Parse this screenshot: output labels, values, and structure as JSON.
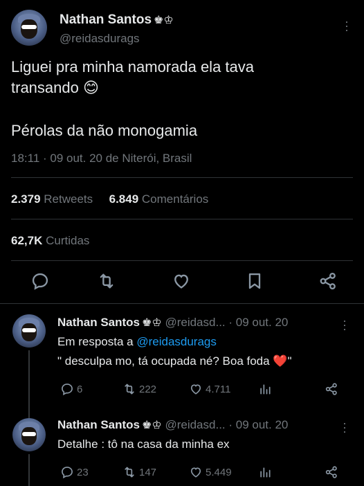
{
  "main_tweet": {
    "author_name": "Nathan Santos",
    "author_badge": "♚♔",
    "handle": "@reidasdurags",
    "text": "Liguei pra minha namorada ela tava\ntransando 😊",
    "text2": "Pérolas da não monogamia",
    "timestamp": "18:11 · 09 out. 20 de Niterói, Brasil",
    "retweets_count": "2.379",
    "retweets_label": "Retweets",
    "comments_count": "6.849",
    "comments_label": "Comentários",
    "likes_count": "62,7K",
    "likes_label": "Curtidas"
  },
  "replies": [
    {
      "author_name": "Nathan Santos",
      "author_badge": "♚♔",
      "handle_time": "@reidasd... · 09 out. 20",
      "reply_prefix": "Em resposta a",
      "reply_to": "@reidasdurags",
      "text": "\" desculpa mo, tá ocupada né? Boa foda ❤️\"",
      "replies": "6",
      "retweets": "222",
      "likes": "4.711"
    },
    {
      "author_name": "Nathan Santos",
      "author_badge": "♚♔",
      "handle_time": "@reidasd... · 09 out. 20",
      "text": "Detalhe : tô na casa da minha ex",
      "replies": "23",
      "retweets": "147",
      "likes": "5.449"
    }
  ],
  "icons": {
    "reply": "reply-icon",
    "retweet": "retweet-icon",
    "like": "heart-icon",
    "bookmark": "bookmark-icon",
    "share": "share-icon",
    "analytics": "analytics-icon",
    "more": "more-icon"
  },
  "colors": {
    "background": "#000000",
    "text": "#e7e9ea",
    "muted": "#71767b",
    "link": "#1d9bf0",
    "divider": "#2f3336"
  }
}
